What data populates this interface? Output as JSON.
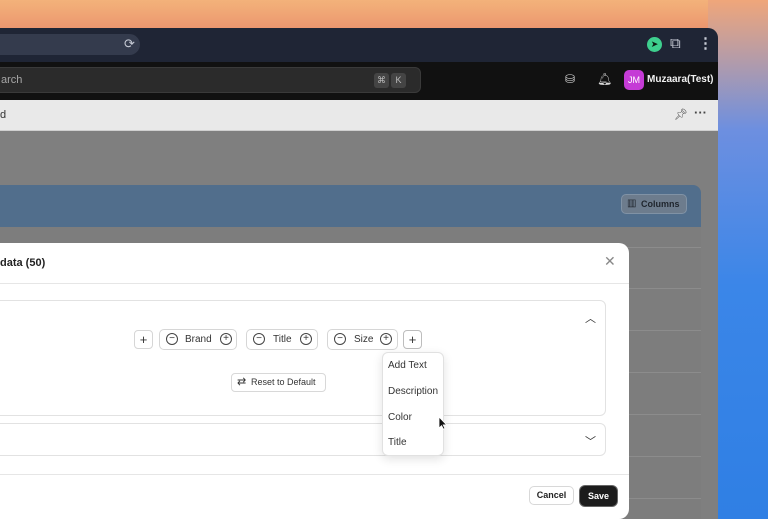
{
  "browser": {
    "reload_icon": "reload-icon",
    "extensions": [
      "cursor-extension-icon",
      "puzzle-icon",
      "kebab-icon"
    ]
  },
  "appbar": {
    "search_placeholder": "arch",
    "shortcut_keys": [
      "⌘",
      "K"
    ],
    "icons": [
      "database-icon",
      "bell-icon"
    ],
    "user_initials": "JM",
    "user_name": "Muzaara(Test)",
    "avatar_color": "#c53bd6"
  },
  "page": {
    "header_title": "d",
    "columns_label": "Columns",
    "header_color": "#516e8c"
  },
  "modal": {
    "title": "data (50)",
    "fields": [
      {
        "label": "Brand"
      },
      {
        "label": "Title"
      },
      {
        "label": "Size"
      }
    ],
    "reset_label": "Reset to Default",
    "cancel_label": "Cancel",
    "save_label": "Save"
  },
  "dropdown": {
    "items": [
      "Add Text",
      "Description",
      "Color",
      "Title"
    ]
  }
}
